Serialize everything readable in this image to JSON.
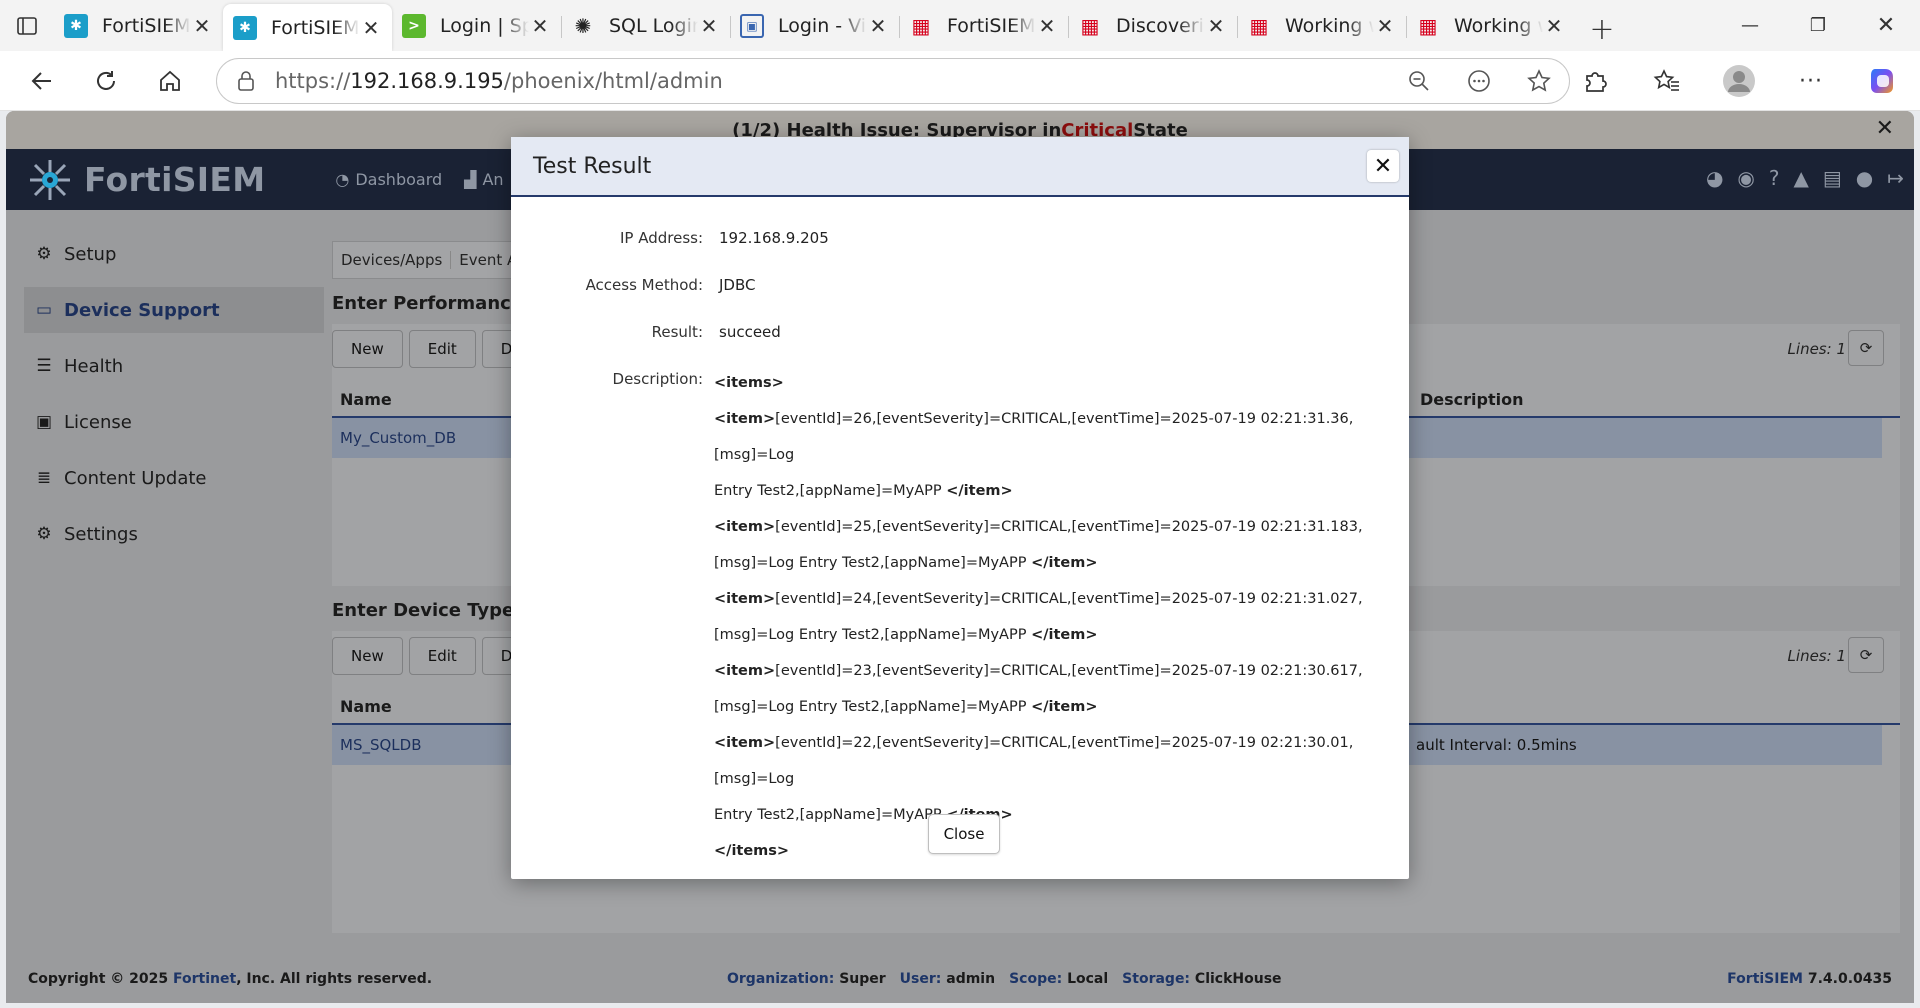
{
  "browser": {
    "tabs": [
      {
        "title": "FortiSIEM",
        "icon": "fortisiem-icon",
        "active": false
      },
      {
        "title": "FortiSIEM",
        "icon": "fortisiem-icon",
        "active": true
      },
      {
        "title": "Login | Sp",
        "icon": "splunk-icon",
        "active": false
      },
      {
        "title": "SQL Login",
        "icon": "openai-icon",
        "active": false
      },
      {
        "title": "Login - Vi",
        "icon": "vm-icon",
        "active": false
      },
      {
        "title": "FortiSIEM",
        "icon": "fortinet-icon",
        "active": false
      },
      {
        "title": "Discoveri",
        "icon": "fortinet-icon",
        "active": false
      },
      {
        "title": "Working w",
        "icon": "fortinet-icon",
        "active": false
      },
      {
        "title": "Working w",
        "icon": "fortinet-icon",
        "active": false
      }
    ],
    "url_prefix": "https://",
    "url_host": "192.168.9.195",
    "url_path": "/phoenix/html/admin"
  },
  "health_banner": {
    "prefix": "(1/2) Health Issue: Supervisor in ",
    "critical": "Critical",
    "suffix": " State"
  },
  "app": {
    "logo": "FortiSIEM",
    "nav": [
      "Dashboard",
      "An"
    ]
  },
  "sidebar": {
    "items": [
      {
        "label": "Setup",
        "icon": "gear-icon"
      },
      {
        "label": "Device Support",
        "icon": "hdd-icon",
        "active": true
      },
      {
        "label": "Health",
        "icon": "list-icon"
      },
      {
        "label": "License",
        "icon": "id-card-icon"
      },
      {
        "label": "Content Update",
        "icon": "database-icon"
      },
      {
        "label": "Settings",
        "icon": "gears-icon"
      }
    ]
  },
  "main": {
    "subtabs": [
      "Devices/Apps",
      "Event At"
    ],
    "section1": {
      "title": "Enter Performance O",
      "buttons": [
        "New",
        "Edit",
        "Dele"
      ],
      "lines": "Lines: 1",
      "col_name": "Name",
      "col_desc": "Description",
      "row_name": "My_Custom_DB",
      "row_desc": ""
    },
    "section2": {
      "title": "Enter Device Type To",
      "buttons": [
        "New",
        "Edit",
        "Dele"
      ],
      "lines": "Lines: 1",
      "col_name": "Name",
      "row_name": "MS_SQLDB",
      "row_desc": "ault Interval: 0.5mins"
    }
  },
  "footer": {
    "copyright_prefix": "Copyright © 2025 ",
    "copyright_brand": "Fortinet",
    "copyright_suffix": ", Inc. All rights reserved.",
    "org_label": "Organization:",
    "org_value": "Super",
    "user_label": "User:",
    "user_value": "admin",
    "scope_label": "Scope:",
    "scope_value": "Local",
    "storage_label": "Storage:",
    "storage_value": "ClickHouse",
    "version_label": "FortiSIEM",
    "version_value": "7.4.0.0435"
  },
  "modal": {
    "title": "Test Result",
    "ip_label": "IP Address:",
    "ip_value": "192.168.9.205",
    "access_label": "Access Method:",
    "access_value": "JDBC",
    "result_label": "Result:",
    "result_value": "succeed",
    "desc_label": "Description:",
    "items_open": "<items>",
    "items_close": "</items>",
    "item_open": "<item>",
    "item_close": "</item>",
    "entries": [
      {
        "a": "[eventId]=26,[eventSeverity]=CRITICAL,[eventTime]=2025-07-19 02:21:31.36,[msg]=Log",
        "b": "Entry Test2,[appName]=MyAPP "
      },
      {
        "a": "[eventId]=25,[eventSeverity]=CRITICAL,[eventTime]=2025-07-19 02:21:31.183,",
        "b": "[msg]=Log Entry Test2,[appName]=MyAPP "
      },
      {
        "a": "[eventId]=24,[eventSeverity]=CRITICAL,[eventTime]=2025-07-19 02:21:31.027,",
        "b": "[msg]=Log Entry Test2,[appName]=MyAPP "
      },
      {
        "a": "[eventId]=23,[eventSeverity]=CRITICAL,[eventTime]=2025-07-19 02:21:30.617,",
        "b": "[msg]=Log Entry Test2,[appName]=MyAPP "
      },
      {
        "a": "[eventId]=22,[eventSeverity]=CRITICAL,[eventTime]=2025-07-19 02:21:30.01,[msg]=Log",
        "b": "Entry Test2,[appName]=MyAPP "
      }
    ],
    "close_label": "Close"
  }
}
